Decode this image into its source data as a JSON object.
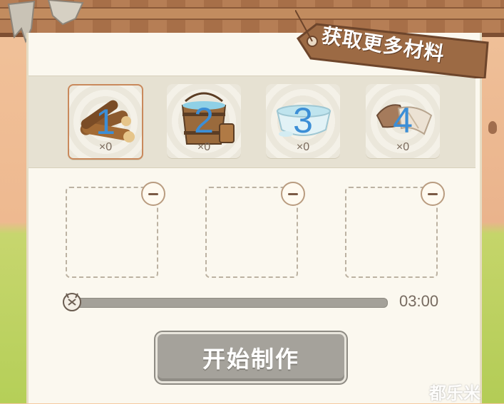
{
  "header": {
    "sign_label": "获取更多材料"
  },
  "materials": [
    {
      "number": "1",
      "count": "×0",
      "name": "wood",
      "selected": true
    },
    {
      "number": "2",
      "count": "×0",
      "name": "water-bucket",
      "selected": false
    },
    {
      "number": "3",
      "count": "×0",
      "name": "bowl",
      "selected": false
    },
    {
      "number": "4",
      "count": "×0",
      "name": "cloth",
      "selected": false
    }
  ],
  "slots": [
    {
      "state": "empty"
    },
    {
      "state": "empty"
    },
    {
      "state": "empty"
    }
  ],
  "timer": {
    "value": "03:00",
    "progress": 0
  },
  "actions": {
    "start_label": "开始制作"
  },
  "watermark": "都乐米",
  "colors": {
    "number_accent": "#3c8ed6",
    "button_disabled": "#a5a29b",
    "selected_border": "#c9895c"
  }
}
